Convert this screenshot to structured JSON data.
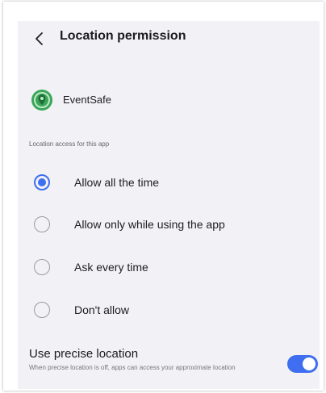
{
  "header": {
    "title": "Location permission",
    "back_icon": "back-arrow-icon"
  },
  "app": {
    "name": "EventSafe",
    "icon": "eventsafe-app-icon",
    "icon_color": "#3aa65a"
  },
  "section": {
    "label": "Location access for this app"
  },
  "options": [
    {
      "label": "Allow all the time",
      "selected": true
    },
    {
      "label": "Allow only while using the app",
      "selected": false
    },
    {
      "label": "Ask every time",
      "selected": false
    },
    {
      "label": "Don't allow",
      "selected": false
    }
  ],
  "precise": {
    "title": "Use precise location",
    "description": "When precise location is off, apps can access your approximate location",
    "enabled": true
  },
  "colors": {
    "accent": "#3f6ff0",
    "background": "#f2f2f6"
  }
}
